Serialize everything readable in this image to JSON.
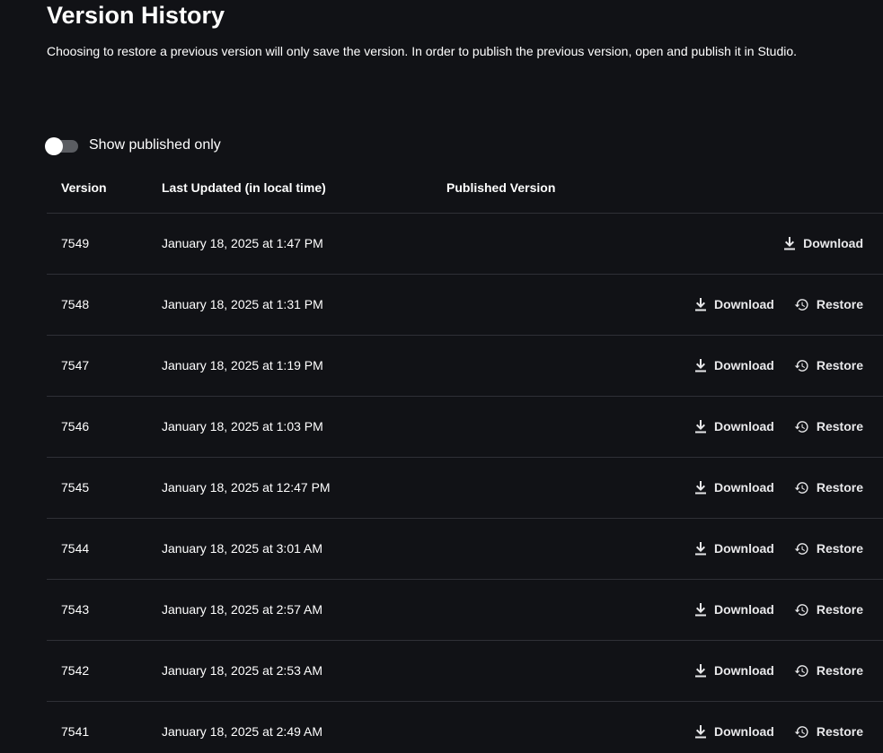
{
  "header": {
    "title": "Version History",
    "description": "Choosing to restore a previous version will only save the version. In order to publish the previous version, open and publish it in Studio."
  },
  "filter": {
    "toggle_label": "Show published only",
    "toggle_on": false
  },
  "table": {
    "columns": {
      "version": "Version",
      "last_updated": "Last Updated (in local time)",
      "published_version": "Published Version"
    },
    "download_label": "Download",
    "restore_label": "Restore",
    "rows": [
      {
        "version": "7549",
        "date": "January 18, 2025 at 1:47 PM",
        "published": "",
        "restore": false
      },
      {
        "version": "7548",
        "date": "January 18, 2025 at 1:31 PM",
        "published": "",
        "restore": true
      },
      {
        "version": "7547",
        "date": "January 18, 2025 at 1:19 PM",
        "published": "",
        "restore": true
      },
      {
        "version": "7546",
        "date": "January 18, 2025 at 1:03 PM",
        "published": "",
        "restore": true
      },
      {
        "version": "7545",
        "date": "January 18, 2025 at 12:47 PM",
        "published": "",
        "restore": true
      },
      {
        "version": "7544",
        "date": "January 18, 2025 at 3:01 AM",
        "published": "",
        "restore": true
      },
      {
        "version": "7543",
        "date": "January 18, 2025 at 2:57 AM",
        "published": "",
        "restore": true
      },
      {
        "version": "7542",
        "date": "January 18, 2025 at 2:53 AM",
        "published": "",
        "restore": true
      },
      {
        "version": "7541",
        "date": "January 18, 2025 at 2:49 AM",
        "published": "",
        "restore": true
      }
    ]
  },
  "icons": {
    "download": "download-icon",
    "restore": "history-restore-icon"
  },
  "colors": {
    "background": "#111216",
    "divider": "#2f3036",
    "text": "#ffffff",
    "toggle_track": "#5b5d62"
  }
}
